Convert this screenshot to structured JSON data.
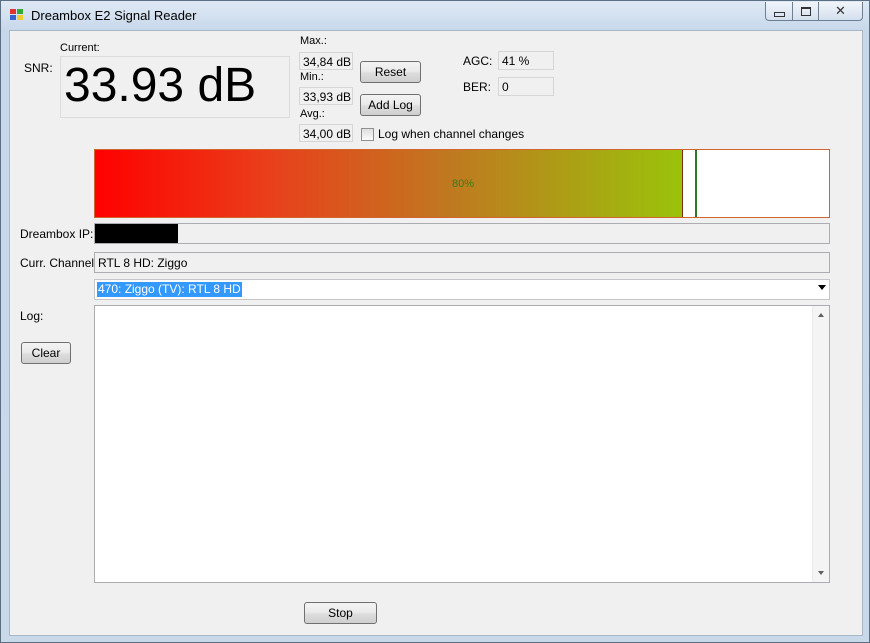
{
  "window": {
    "title": "Dreambox E2 Signal Reader",
    "controls": {
      "minimize": "▭",
      "maximize": "▢",
      "close": "✕"
    }
  },
  "snr": {
    "label": "SNR:",
    "current_label": "Current:",
    "current_value": "33.93 dB"
  },
  "stats": {
    "max_label": "Max.:",
    "max_value": "34,84 dB",
    "min_label": "Min.:",
    "min_value": "33,93 dB",
    "avg_label": "Avg.:",
    "avg_value": "34,00 dB"
  },
  "buttons": {
    "reset": "Reset",
    "add_log": "Add Log",
    "clear": "Clear",
    "stop": "Stop"
  },
  "log_on_change": {
    "label": "Log when channel changes",
    "checked": false
  },
  "agc": {
    "label": "AGC:",
    "value": "41 %"
  },
  "ber": {
    "label": "BER:",
    "value": "0"
  },
  "signal_meter": {
    "percent_text": "80%",
    "fill_fraction": 0.8,
    "marker_fraction": 0.818,
    "colors": {
      "start": "#ff0000",
      "end": "#9ac30a",
      "marker": "#2a7a2a",
      "border": "#d2642d"
    }
  },
  "dreambox_ip": {
    "label": "Dreambox IP:",
    "value": ""
  },
  "current_channel": {
    "label": "Curr. Channel:",
    "value": "RTL 8 HD: Ziggo"
  },
  "channel_select": {
    "selected": "470: Ziggo (TV): RTL 8 HD"
  },
  "log": {
    "label": "Log:",
    "content": ""
  }
}
